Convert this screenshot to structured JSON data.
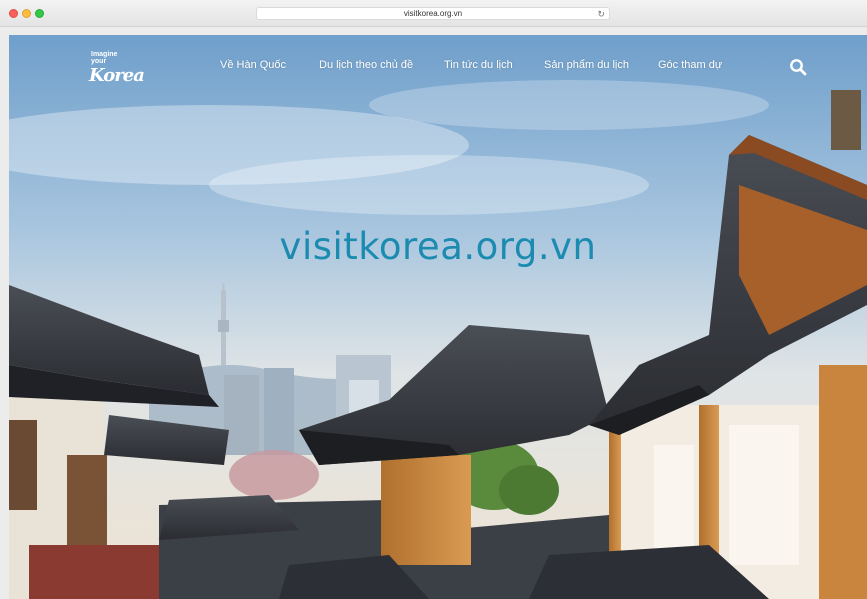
{
  "browser": {
    "url": "visitkorea.org.vn"
  },
  "logo": {
    "tagline": "Imagine your",
    "wordmark": "Korea"
  },
  "nav": {
    "items": [
      {
        "label": "Về Hàn Quốc"
      },
      {
        "label": "Du lịch theo chủ đề"
      },
      {
        "label": "Tin tức du lịch"
      },
      {
        "label": "Sản phẩm du lịch"
      },
      {
        "label": "Góc tham dự"
      }
    ],
    "search_icon": "search-icon"
  },
  "hero": {
    "title": "visitkorea.org.vn"
  },
  "colors": {
    "hero_title": "#1b8bb0",
    "nav_text": "#ffffff"
  }
}
